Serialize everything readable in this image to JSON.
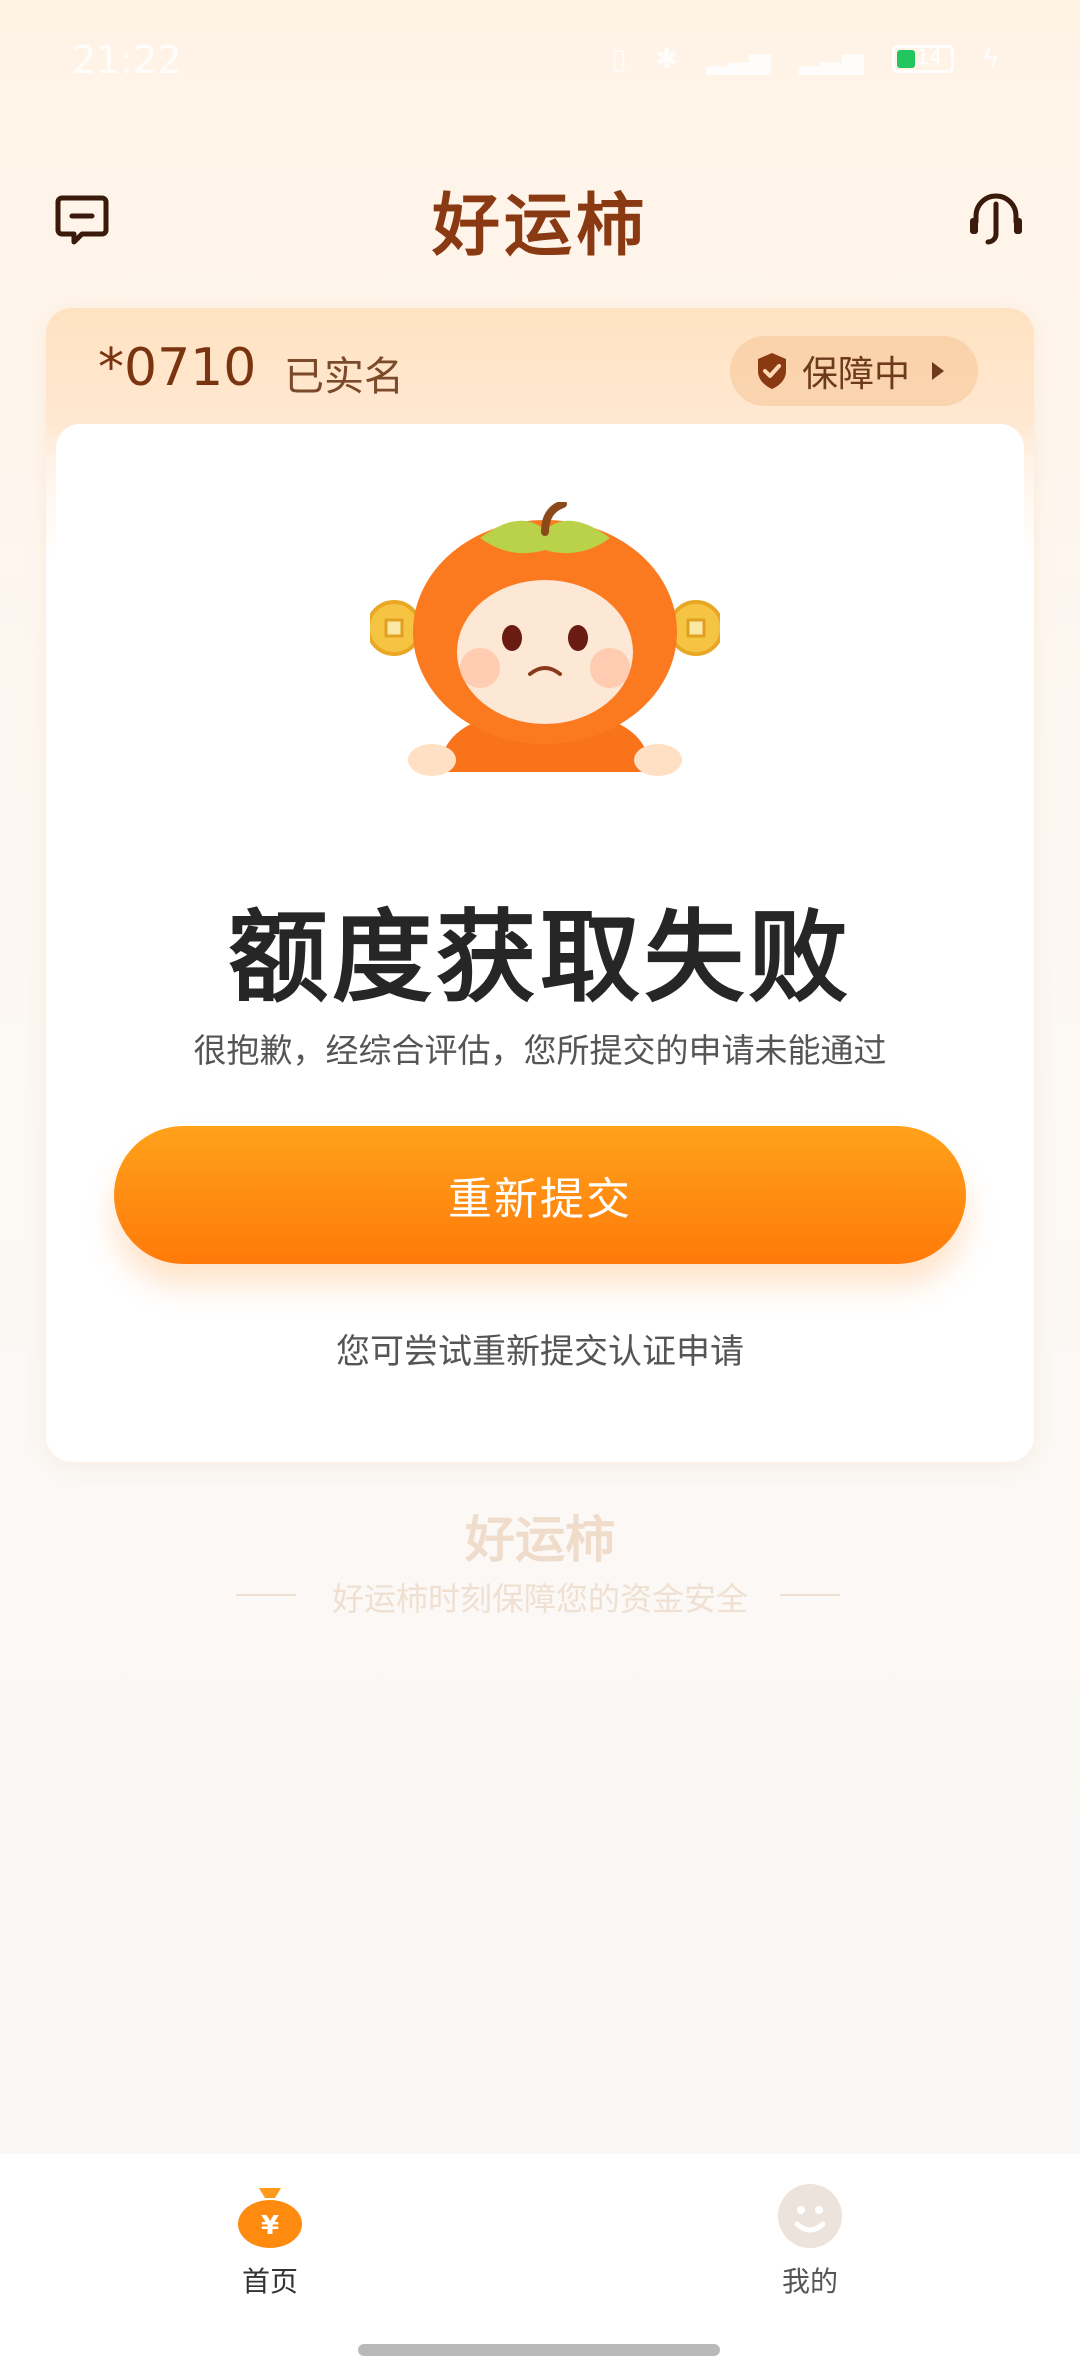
{
  "status_bar": {
    "time": "21:22",
    "battery": "14"
  },
  "header": {
    "title": "好运柿",
    "message_icon": "message-icon",
    "service_icon": "headset-icon"
  },
  "account": {
    "masked_number": "*0710",
    "verified_label": "已实名",
    "guard_label": "保障中"
  },
  "result": {
    "title": "额度获取失败",
    "subtitle": "很抱歉，经综合评估，您所提交的申请未能通过",
    "button_label": "重新提交",
    "hint": "您可尝试重新提交认证申请"
  },
  "footer": {
    "brand": "好运柿",
    "slogan": "好运柿时刻保障您的资金安全"
  },
  "bottom_nav": {
    "items": [
      {
        "label": "首页",
        "icon": "money-bag-icon"
      },
      {
        "label": "我的",
        "icon": "smiley-icon"
      }
    ]
  },
  "colors": {
    "brand": "#8a3a12",
    "button": "#ff8a0f",
    "success_battery": "#22c55e"
  }
}
